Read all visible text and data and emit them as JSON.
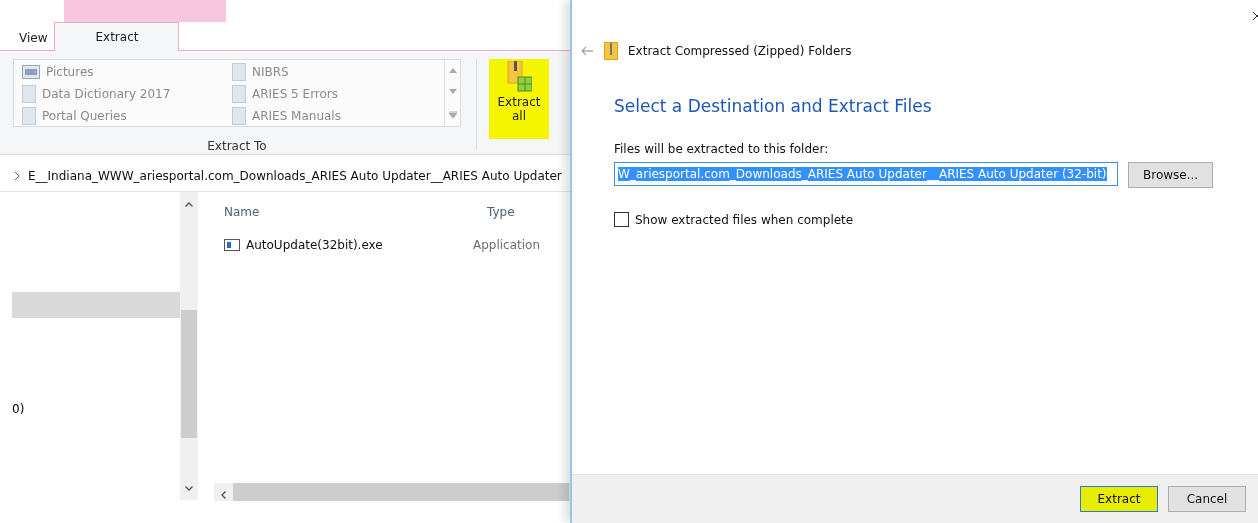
{
  "explorer": {
    "tabs": [
      {
        "label": "View",
        "selected": false
      },
      {
        "label": "Extract",
        "selected": true
      }
    ],
    "gallery": [
      {
        "label": "Pictures",
        "kind": "pictures"
      },
      {
        "label": "NIBRS",
        "kind": "folder"
      },
      {
        "label": "Data Dictionary 2017",
        "kind": "folder"
      },
      {
        "label": "ARIES 5 Errors",
        "kind": "folder"
      },
      {
        "label": "Portal Queries",
        "kind": "folder"
      },
      {
        "label": "ARIES Manuals",
        "kind": "folder"
      }
    ],
    "extract_all": {
      "label": "Extract all",
      "highlighted": true
    },
    "group_label": "Extract To",
    "address": "E__Indiana_WWW_ariesportal.com_Downloads_ARIES Auto Updater__ARIES Auto Updater",
    "nav_pane": {
      "selected_row": true,
      "fragment": "0)"
    },
    "columns": [
      "Name",
      "Type"
    ],
    "files": [
      {
        "name": "AutoUpdate(32bit).exe",
        "type": "Application"
      }
    ]
  },
  "dialog": {
    "title": "Extract Compressed (Zipped) Folders",
    "heading": "Select a Destination and Extract Files",
    "field_label": "Files will be extracted to this folder:",
    "path": "W_ariesportal.com_Downloads_ARIES Auto Updater__ARIES Auto Updater (32-bit)",
    "path_selected": true,
    "browse": "Browse...",
    "show_files": {
      "label": "Show extracted files when complete",
      "checked": false
    },
    "buttons": [
      {
        "label": "Extract",
        "highlighted": true
      },
      {
        "label": "Cancel",
        "highlighted": false
      }
    ]
  }
}
